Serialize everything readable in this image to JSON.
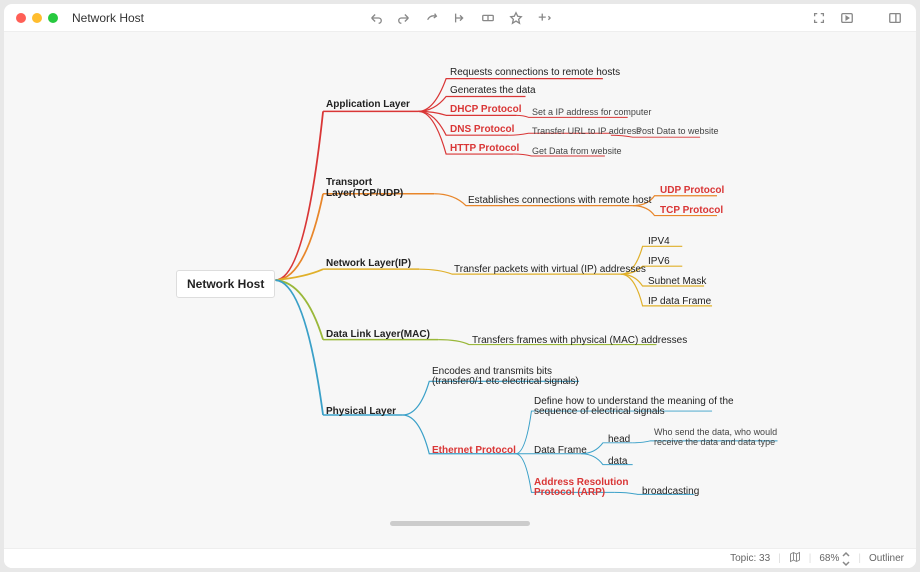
{
  "title": "Network Host",
  "statusbar": {
    "topic_label": "Topic:",
    "topic_count": "33",
    "zoom": "68%",
    "mode": "Outliner"
  },
  "root": "Network Host",
  "branches": {
    "app": {
      "label": "Application Layer",
      "children": {
        "req": "Requests connections to remote hosts",
        "gen": "Generates the data",
        "dhcp": "DHCP Protocol",
        "dhcp_note": "Set a IP address for computer",
        "dns": "DNS Protocol",
        "dns_note1": "Transfer URL to IP address",
        "dns_note2": "Post Data to website",
        "http": "HTTP Protocol",
        "http_note": "Get Data from website"
      }
    },
    "transport": {
      "label": "Transport Layer(TCP/UDP)",
      "est": "Establishes connections with remote host",
      "udp": "UDP Protocol",
      "tcp": "TCP Protocol"
    },
    "network": {
      "label": "Network Layer(IP)",
      "xfer": "Transfer packets with virtual (IP) addresses",
      "ipv4": "IPV4",
      "ipv6": "IPV6",
      "subnet": "Subnet  Mask",
      "frame": "IP data Frame"
    },
    "datalink": {
      "label": "Data Link Layer(MAC)",
      "xfer": "Transfers frames with physical (MAC) addresses"
    },
    "physical": {
      "label": "Physical Layer",
      "encodes1": "Encodes and transmits bits",
      "encodes2": "(transfer0/1 etc electrical signals)",
      "eth": "Ethernet Protocol",
      "def1": "Define how to understand the meaning of the",
      "def2": "sequence of electrical signals",
      "df": "Data Frame",
      "head": "head",
      "head_note1": "Who send the data, who would",
      "head_note2": "receive the data and data type",
      "data": "data",
      "arp1": "Address Resolution",
      "arp2": "Protocol (ARP)",
      "arp_note": "broadcasting"
    }
  }
}
